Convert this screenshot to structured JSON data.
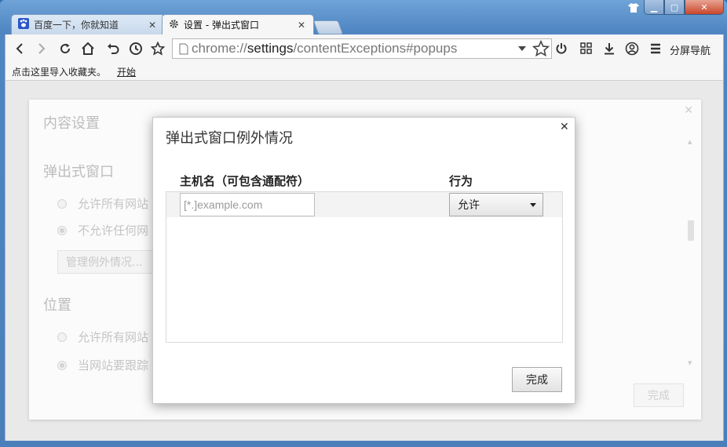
{
  "tabs": [
    {
      "title": "百度一下，你就知道",
      "icon": "paw-icon",
      "active": false
    },
    {
      "title": "设置 - 弹出式窗口",
      "icon": "gear-icon",
      "active": true
    }
  ],
  "omnibox": {
    "url_scheme": "chrome://",
    "url_host": "settings",
    "url_path": "/contentExceptions#popups"
  },
  "toolbar": {
    "split_nav_label": "分屏导航"
  },
  "bookmarks": {
    "prompt": "点击这里导入收藏夹。",
    "start_link": "开始"
  },
  "settings": {
    "title": "内容设置",
    "popup_heading": "弹出式窗口",
    "popup_allow_all": "允许所有网站",
    "popup_block_all": "不允许任何网",
    "manage_exceptions": "管理例外情况...",
    "location_heading": "位置",
    "location_allow_all": "允许所有网站",
    "location_ask": "当网站要跟踪",
    "done_label": "完成"
  },
  "dialog": {
    "title": "弹出式窗口例外情况",
    "column_host": "主机名（可包含通配符）",
    "column_action": "行为",
    "host_placeholder": "[*.]example.com",
    "host_value": "",
    "action_selected": "允许",
    "done_label": "完成"
  },
  "colors": {
    "frame_blue": "#4f86c2",
    "close_red": "#c9452b"
  }
}
